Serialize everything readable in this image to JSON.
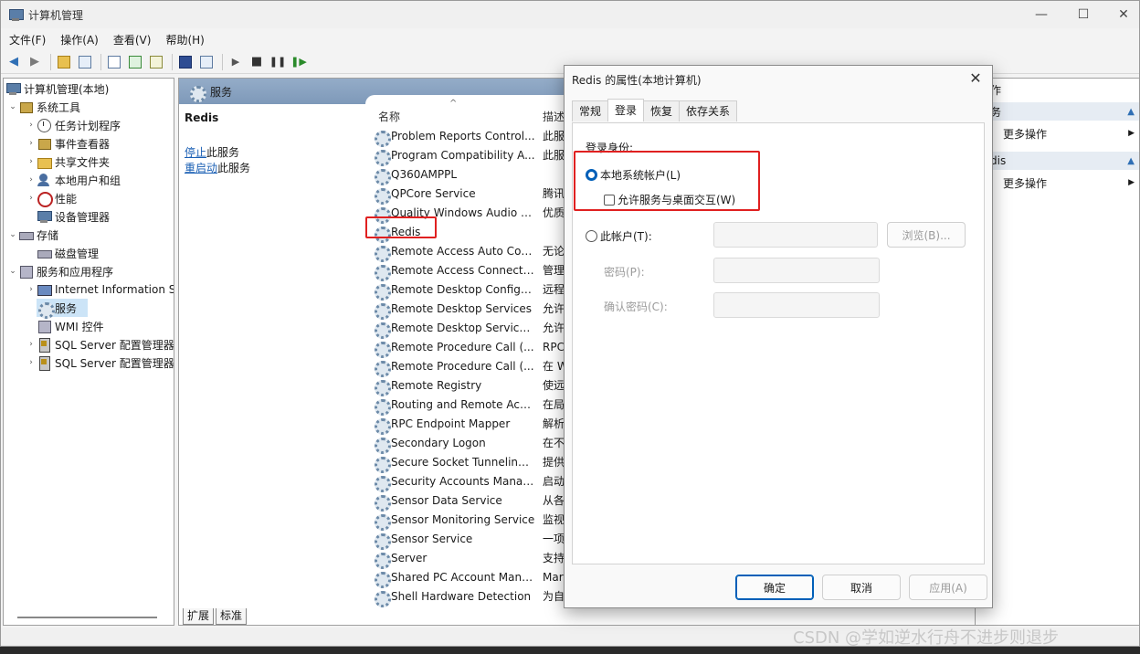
{
  "window": {
    "title": "计算机管理",
    "minimize": "—",
    "maximize": "☐",
    "close": "✕"
  },
  "menu": [
    "文件(F)",
    "操作(A)",
    "查看(V)",
    "帮助(H)"
  ],
  "tree": {
    "root": "计算机管理(本地)",
    "system_tools": "系统工具",
    "task_scheduler": "任务计划程序",
    "event_viewer": "事件查看器",
    "shared_folders": "共享文件夹",
    "local_users": "本地用户和组",
    "performance": "性能",
    "device_manager": "设备管理器",
    "storage": "存储",
    "disk_management": "磁盘管理",
    "services_apps": "服务和应用程序",
    "iis": "Internet Information S",
    "services": "服务",
    "wmi": "WMI 控件",
    "sql1": "SQL Server 配置管理器",
    "sql2": "SQL Server 配置管理器"
  },
  "content": {
    "header": "服务",
    "selected_name": "Redis",
    "stop_link": "停止",
    "stop_suffix": "此服务",
    "restart_link": "重启动",
    "restart_suffix": "此服务",
    "col_name": "名称",
    "col_desc": "描述",
    "sort_arrow": "^",
    "services": [
      {
        "name": "Problem Reports Control...",
        "desc": "此服"
      },
      {
        "name": "Program Compatibility A...",
        "desc": "此服"
      },
      {
        "name": "Q360AMPPL",
        "desc": ""
      },
      {
        "name": "QPCore Service",
        "desc": "腾讯"
      },
      {
        "name": "Quality Windows Audio V...",
        "desc": "优质"
      },
      {
        "name": "Redis",
        "desc": ""
      },
      {
        "name": "Remote Access Auto Con...",
        "desc": "无论"
      },
      {
        "name": "Remote Access Connecti...",
        "desc": "管理"
      },
      {
        "name": "Remote Desktop Configu...",
        "desc": "远程"
      },
      {
        "name": "Remote Desktop Services",
        "desc": "允许"
      },
      {
        "name": "Remote Desktop Service...",
        "desc": "允许"
      },
      {
        "name": "Remote Procedure Call (...",
        "desc": "RPC"
      },
      {
        "name": "Remote Procedure Call (...",
        "desc": "在 W"
      },
      {
        "name": "Remote Registry",
        "desc": "使远"
      },
      {
        "name": "Routing and Remote Acc...",
        "desc": "在局"
      },
      {
        "name": "RPC Endpoint Mapper",
        "desc": "解析"
      },
      {
        "name": "Secondary Logon",
        "desc": "在不"
      },
      {
        "name": "Secure Socket Tunneling ...",
        "desc": "提供"
      },
      {
        "name": "Security Accounts Manag...",
        "desc": "启动"
      },
      {
        "name": "Sensor Data Service",
        "desc": "从各"
      },
      {
        "name": "Sensor Monitoring Service",
        "desc": "监视"
      },
      {
        "name": "Sensor Service",
        "desc": "一项"
      },
      {
        "name": "Server",
        "desc": "支持"
      },
      {
        "name": "Shared PC Account Mana...",
        "desc": "Mar"
      },
      {
        "name": "Shell Hardware Detection",
        "desc": "为自"
      }
    ],
    "tab_extended": "扩展",
    "tab_standard": "标准"
  },
  "actions": {
    "header1": "务",
    "more1": "更多操作",
    "header2": "dis",
    "more2": "更多操作",
    "top": "作"
  },
  "dialog": {
    "title": "Redis 的属性(本地计算机)",
    "close": "✕",
    "tabs": [
      "常规",
      "登录",
      "恢复",
      "依存关系"
    ],
    "active_tab": 1,
    "logon_as": "登录身份:",
    "local_system": "本地系统帐户(L)",
    "allow_desktop": "允许服务与桌面交互(W)",
    "this_account": "此帐户(T):",
    "browse": "浏览(B)...",
    "password": "密码(P):",
    "confirm_password": "确认密码(C):",
    "ok": "确定",
    "cancel": "取消",
    "apply": "应用(A)"
  },
  "watermark": "CSDN @学如逆水行舟不进步则退步",
  "colors": {
    "accent": "#005fb8",
    "highlight": "#e02020",
    "header": "#7e99b9"
  }
}
